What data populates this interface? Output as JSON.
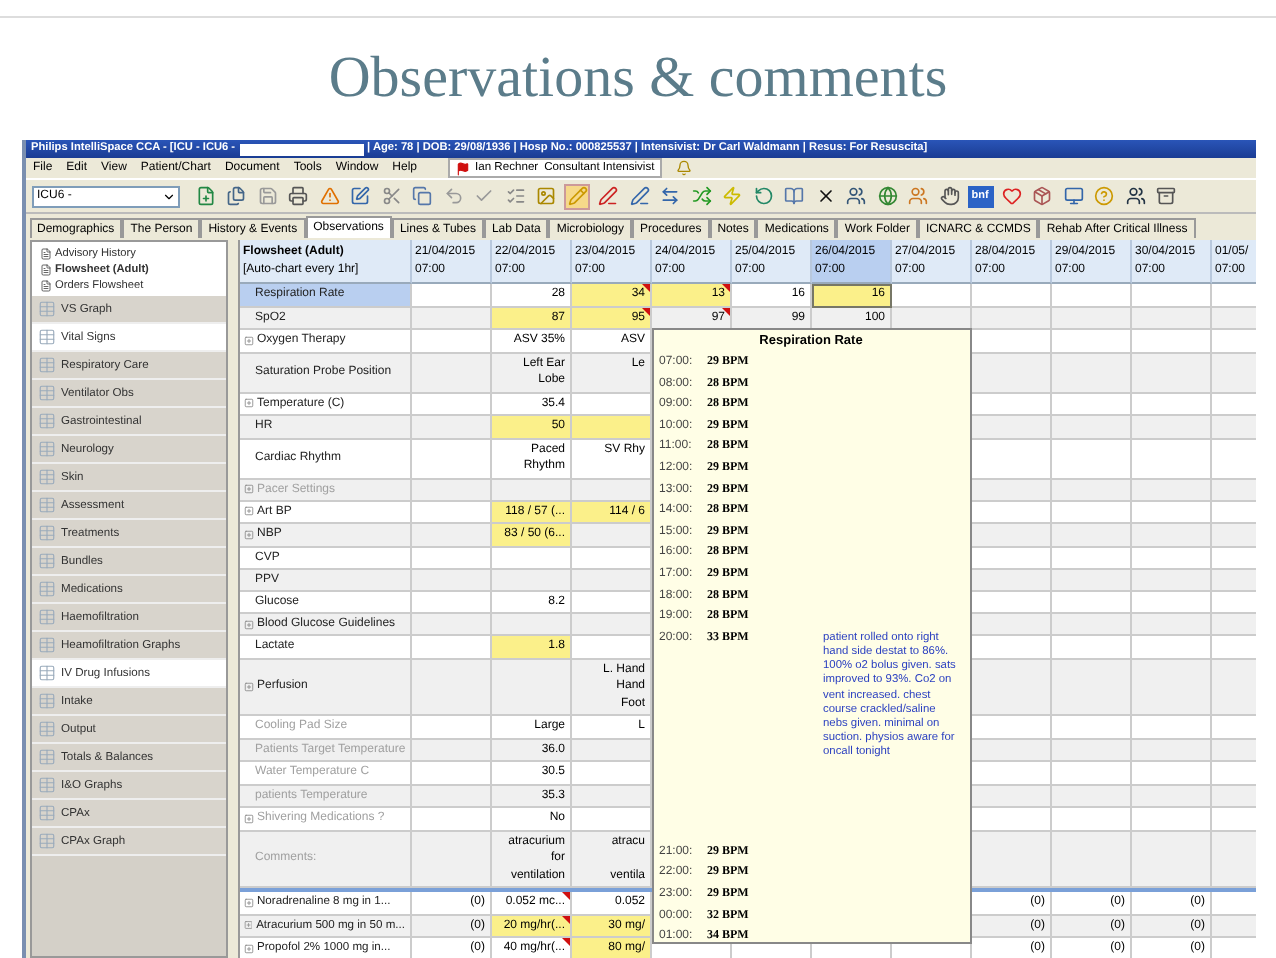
{
  "slide": {
    "title": "Observations & comments"
  },
  "window": {
    "title_left": "Philips IntelliSpace CCA - [ICU - ICU6 -",
    "title_right": "| Age: 78 | DOB: 29/08/1936 | Hosp No.: 000825537 | Intensivist: Dr Carl Waldmann | Resus: For Resuscita]"
  },
  "menu": [
    "File",
    "Edit",
    "View",
    "Patient/Chart",
    "Document",
    "Tools",
    "Window",
    "Help"
  ],
  "user": {
    "name": "Ian Rechner",
    "role": "Consultant Intensivist"
  },
  "toolbar": {
    "unit_select": "ICU6 -",
    "badge": "bnf"
  },
  "tabs": [
    {
      "label": "Demographics",
      "selected": false
    },
    {
      "label": "The Person",
      "selected": false
    },
    {
      "label": "History & Events",
      "selected": false
    },
    {
      "label": "Observations",
      "selected": true
    },
    {
      "label": "Lines & Tubes",
      "selected": false
    },
    {
      "label": "Lab Data",
      "selected": false
    },
    {
      "label": "Microbiology",
      "selected": false
    },
    {
      "label": "Procedures",
      "selected": false
    },
    {
      "label": "Notes",
      "selected": false
    },
    {
      "label": "Medications",
      "selected": false
    },
    {
      "label": "Work Folder",
      "selected": false
    },
    {
      "label": "ICNARC & CCMDS",
      "selected": false
    },
    {
      "label": "Rehab After Critical Illness",
      "selected": false
    }
  ],
  "sidebar": {
    "tree": [
      {
        "label": "Advisory History",
        "selected": false
      },
      {
        "label": "Flowsheet (Adult)",
        "selected": true
      },
      {
        "label": "Orders Flowsheet",
        "selected": false
      }
    ],
    "items": [
      {
        "label": "VS Graph",
        "selected": false
      },
      {
        "label": "Vital Signs",
        "selected": true
      },
      {
        "label": "Respiratory Care",
        "selected": false
      },
      {
        "label": "Ventilator Obs",
        "selected": false
      },
      {
        "label": "Gastrointestinal",
        "selected": false
      },
      {
        "label": "Neurology",
        "selected": false
      },
      {
        "label": "Skin",
        "selected": false
      },
      {
        "label": "Assessment",
        "selected": false
      },
      {
        "label": "Treatments",
        "selected": false
      },
      {
        "label": "Bundles",
        "selected": false
      },
      {
        "label": "Medications",
        "selected": false
      },
      {
        "label": "Haemofiltration",
        "selected": false
      },
      {
        "label": "Heamofiltration Graphs",
        "selected": false
      },
      {
        "label": "IV Drug Infusions",
        "selected": true
      },
      {
        "label": "Intake",
        "selected": false
      },
      {
        "label": "Output",
        "selected": false
      },
      {
        "label": "Totals & Balances",
        "selected": false
      },
      {
        "label": "I&O Graphs",
        "selected": false
      },
      {
        "label": "CPAx",
        "selected": false
      },
      {
        "label": "CPAx Graph",
        "selected": false
      }
    ]
  },
  "flowsheet": {
    "title": "Flowsheet (Adult)",
    "subtitle": "[Auto-chart every 1hr]",
    "columns": [
      {
        "date": "21/04/2015",
        "time": "07:00",
        "selected": false
      },
      {
        "date": "22/04/2015",
        "time": "07:00",
        "selected": false
      },
      {
        "date": "23/04/2015",
        "time": "07:00",
        "selected": false
      },
      {
        "date": "24/04/2015",
        "time": "07:00",
        "selected": false
      },
      {
        "date": "25/04/2015",
        "time": "07:00",
        "selected": false
      },
      {
        "date": "26/04/2015",
        "time": "07:00",
        "selected": true
      },
      {
        "date": "27/04/2015",
        "time": "07:00",
        "selected": false
      },
      {
        "date": "28/04/2015",
        "time": "07:00",
        "selected": false
      },
      {
        "date": "29/04/2015",
        "time": "07:00",
        "selected": false
      },
      {
        "date": "30/04/2015",
        "time": "07:00",
        "selected": false
      },
      {
        "date": "01/05/",
        "time": "07:00",
        "selected": false
      }
    ],
    "rows": [
      {
        "kind": "obs",
        "label": "Respiration Rate",
        "expandable": false,
        "disabled": false,
        "selected": true,
        "cells": [
          null,
          {
            "text": "28",
            "highlighted": false,
            "flagged": false
          },
          {
            "text": "34",
            "highlighted": true,
            "flagged": true
          },
          {
            "text": "13",
            "highlighted": true,
            "flagged": true
          },
          {
            "text": "16",
            "highlighted": false,
            "flagged": false
          },
          {
            "text": "16",
            "highlighted": true,
            "flagged": false
          },
          null,
          null,
          null,
          null,
          null
        ]
      },
      {
        "kind": "obs",
        "label": "SpO2",
        "expandable": false,
        "disabled": false,
        "selected": false,
        "cells": [
          null,
          {
            "text": "87",
            "highlighted": true,
            "flagged": false
          },
          {
            "text": "95",
            "highlighted": true,
            "flagged": true
          },
          {
            "text": "97",
            "highlighted": false,
            "flagged": true
          },
          {
            "text": "99",
            "highlighted": false,
            "flagged": false
          },
          {
            "text": "100",
            "highlighted": false,
            "flagged": false
          },
          null,
          null,
          null,
          null,
          null
        ]
      },
      {
        "kind": "obs",
        "label": "Oxygen Therapy",
        "expandable": true,
        "disabled": false,
        "selected": false,
        "cells": [
          null,
          {
            "text": "ASV 35%",
            "highlighted": false,
            "flagged": false
          },
          {
            "text": "ASV",
            "highlighted": false,
            "flagged": false
          },
          null,
          null,
          null,
          null,
          null,
          null,
          null,
          null
        ]
      },
      {
        "kind": "obs",
        "label": "Saturation Probe Position",
        "expandable": false,
        "disabled": false,
        "selected": false,
        "cells": [
          null,
          {
            "text": "Left Ear\nLobe",
            "highlighted": false,
            "flagged": false
          },
          {
            "text": "Le",
            "highlighted": false,
            "flagged": false
          },
          null,
          null,
          null,
          null,
          null,
          null,
          null,
          null
        ]
      },
      {
        "kind": "obs",
        "label": "Temperature (C)",
        "expandable": true,
        "disabled": false,
        "selected": false,
        "cells": [
          null,
          {
            "text": "35.4",
            "highlighted": false,
            "flagged": false
          },
          null,
          null,
          null,
          null,
          null,
          null,
          null,
          null,
          null
        ]
      },
      {
        "kind": "obs",
        "label": "HR",
        "expandable": false,
        "disabled": false,
        "selected": false,
        "cells": [
          null,
          {
            "text": "50",
            "highlighted": true,
            "flagged": false
          },
          {
            "highlighted": true,
            "flagged": false
          },
          null,
          null,
          null,
          null,
          null,
          null,
          null,
          null
        ]
      },
      {
        "kind": "obs",
        "label": "Cardiac Rhythm",
        "expandable": false,
        "disabled": false,
        "selected": false,
        "cells": [
          null,
          {
            "text": "Paced\nRhythm",
            "highlighted": false,
            "flagged": false
          },
          {
            "text": "SV Rhy",
            "highlighted": false,
            "flagged": false
          },
          null,
          null,
          null,
          null,
          null,
          null,
          null,
          null
        ]
      },
      {
        "kind": "obs",
        "label": "Pacer Settings",
        "expandable": true,
        "disabled": true,
        "selected": false,
        "cells": [
          null,
          null,
          null,
          null,
          null,
          null,
          null,
          null,
          null,
          null,
          null
        ]
      },
      {
        "kind": "obs",
        "label": "Art BP",
        "expandable": true,
        "disabled": false,
        "selected": false,
        "cells": [
          null,
          {
            "text": "118 / 57 (...",
            "highlighted": true,
            "flagged": false
          },
          {
            "text": "114 / 6",
            "highlighted": true,
            "flagged": false
          },
          null,
          null,
          null,
          null,
          null,
          null,
          null,
          null
        ]
      },
      {
        "kind": "obs",
        "label": "NBP",
        "expandable": true,
        "disabled": false,
        "selected": false,
        "cells": [
          null,
          {
            "text": "83 / 50 (6...",
            "highlighted": true,
            "flagged": false
          },
          null,
          null,
          null,
          null,
          null,
          null,
          null,
          null,
          null
        ]
      },
      {
        "kind": "obs",
        "label": "CVP",
        "expandable": false,
        "disabled": false,
        "selected": false,
        "cells": [
          null,
          null,
          null,
          null,
          null,
          null,
          null,
          null,
          null,
          null,
          null
        ]
      },
      {
        "kind": "obs",
        "label": "PPV",
        "expandable": false,
        "disabled": false,
        "selected": false,
        "cells": [
          null,
          null,
          null,
          null,
          null,
          null,
          null,
          null,
          null,
          null,
          null
        ]
      },
      {
        "kind": "obs",
        "label": "Glucose",
        "expandable": false,
        "disabled": false,
        "selected": false,
        "cells": [
          null,
          {
            "text": "8.2",
            "highlighted": false,
            "flagged": false
          },
          null,
          null,
          null,
          null,
          null,
          null,
          null,
          null,
          null
        ]
      },
      {
        "kind": "obs",
        "label": "Blood Glucose Guidelines",
        "expandable": true,
        "disabled": false,
        "selected": false,
        "cells": [
          null,
          null,
          null,
          null,
          null,
          null,
          null,
          null,
          null,
          null,
          null
        ]
      },
      {
        "kind": "obs",
        "label": "Lactate",
        "expandable": false,
        "disabled": false,
        "selected": false,
        "cells": [
          null,
          {
            "text": "1.8",
            "highlighted": true,
            "flagged": false
          },
          null,
          null,
          null,
          null,
          null,
          null,
          null,
          null,
          null
        ]
      },
      {
        "kind": "obs",
        "label": "Perfusion",
        "expandable": true,
        "disabled": false,
        "selected": false,
        "cells": [
          null,
          null,
          {
            "text": "L. Hand\nHand\nFoot",
            "highlighted": false,
            "flagged": false
          },
          null,
          null,
          null,
          null,
          null,
          null,
          null,
          null
        ]
      },
      {
        "kind": "obs",
        "label": "Cooling Pad Size",
        "expandable": false,
        "disabled": true,
        "selected": false,
        "cells": [
          null,
          {
            "text": "Large",
            "highlighted": false,
            "flagged": false
          },
          {
            "text": "L",
            "highlighted": false,
            "flagged": false
          },
          null,
          null,
          null,
          null,
          null,
          null,
          null,
          null
        ]
      },
      {
        "kind": "obs",
        "label": "Patients Target Temperature",
        "expandable": false,
        "disabled": true,
        "selected": false,
        "cells": [
          null,
          {
            "text": "36.0",
            "highlighted": false,
            "flagged": false
          },
          null,
          null,
          null,
          null,
          null,
          null,
          null,
          null,
          null
        ]
      },
      {
        "kind": "obs",
        "label": "Water Temperature C",
        "expandable": false,
        "disabled": true,
        "selected": false,
        "cells": [
          null,
          {
            "text": "30.5",
            "highlighted": false,
            "flagged": false
          },
          null,
          null,
          null,
          null,
          null,
          null,
          null,
          null,
          null
        ]
      },
      {
        "kind": "obs",
        "label": "patients Temperature",
        "expandable": false,
        "disabled": true,
        "selected": false,
        "cells": [
          null,
          {
            "text": "35.3",
            "highlighted": false,
            "flagged": false
          },
          null,
          null,
          null,
          null,
          null,
          null,
          null,
          null,
          null
        ]
      },
      {
        "kind": "obs",
        "label": "Shivering Medications ?",
        "expandable": true,
        "disabled": true,
        "selected": false,
        "cells": [
          null,
          {
            "text": "No",
            "highlighted": false,
            "flagged": false
          },
          null,
          null,
          null,
          null,
          null,
          null,
          null,
          null,
          null
        ]
      },
      {
        "kind": "obs",
        "label": "Comments:",
        "expandable": false,
        "disabled": true,
        "selected": false,
        "cells": [
          null,
          {
            "text": "atracurium\nfor\nventilation",
            "highlighted": false,
            "flagged": false
          },
          {
            "text": "atracu\n\nventila",
            "highlighted": false,
            "flagged": false
          },
          null,
          null,
          null,
          null,
          null,
          null,
          null,
          null
        ]
      },
      {
        "kind": "drug",
        "label": "Noradrenaline 8 mg in 1...",
        "expandable": true,
        "disabled": false,
        "selected": false,
        "cells": [
          {
            "text": "(0)",
            "highlighted": false,
            "flagged": false
          },
          {
            "text": "0.052 mc...",
            "highlighted": false,
            "flagged": true
          },
          {
            "text": "0.052",
            "highlighted": false,
            "flagged": false
          },
          null,
          null,
          null,
          null,
          {
            "text": "(0)",
            "highlighted": false,
            "flagged": false
          },
          {
            "text": "(0)",
            "highlighted": false,
            "flagged": false
          },
          {
            "text": "(0)",
            "highlighted": false,
            "flagged": false
          },
          null
        ]
      },
      {
        "kind": "drug",
        "label": "Atracurium 500 mg in 50 m...",
        "expandable": true,
        "disabled": false,
        "selected": false,
        "cells": [
          {
            "text": "(0)",
            "highlighted": false,
            "flagged": false
          },
          {
            "text": "20 mg/hr(...",
            "highlighted": true,
            "flagged": true
          },
          {
            "text": "30 mg/",
            "highlighted": true,
            "flagged": false
          },
          null,
          null,
          null,
          null,
          {
            "text": "(0)",
            "highlighted": false,
            "flagged": false
          },
          {
            "text": "(0)",
            "highlighted": false,
            "flagged": false
          },
          {
            "text": "(0)",
            "highlighted": false,
            "flagged": false
          },
          null
        ]
      },
      {
        "kind": "drug",
        "label": "Propofol 2% 1000 mg in...",
        "expandable": true,
        "disabled": false,
        "selected": false,
        "cells": [
          {
            "text": "(0)",
            "highlighted": false,
            "flagged": false
          },
          {
            "text": "40 mg/hr(...",
            "highlighted": false,
            "flagged": true
          },
          {
            "text": "80 mg/",
            "highlighted": true,
            "flagged": false
          },
          null,
          null,
          null,
          null,
          {
            "text": "(0)",
            "highlighted": false,
            "flagged": false
          },
          {
            "text": "(0)",
            "highlighted": false,
            "flagged": false
          },
          {
            "text": "(0)",
            "highlighted": false,
            "flagged": false
          },
          null
        ]
      }
    ]
  },
  "popup": {
    "title": "Respiration Rate",
    "entries": [
      {
        "time": "07:00:",
        "value": "29 BPM"
      },
      {
        "time": "08:00:",
        "value": "28 BPM"
      },
      {
        "time": "09:00:",
        "value": "28 BPM"
      },
      {
        "time": "10:00:",
        "value": "29 BPM"
      },
      {
        "time": "11:00:",
        "value": "28 BPM"
      },
      {
        "time": "12:00:",
        "value": "29 BPM"
      },
      {
        "time": "13:00:",
        "value": "29 BPM"
      },
      {
        "time": "14:00:",
        "value": "28 BPM"
      },
      {
        "time": "15:00:",
        "value": "29 BPM"
      },
      {
        "time": "16:00:",
        "value": "28 BPM"
      },
      {
        "time": "17:00:",
        "value": "29 BPM"
      },
      {
        "time": "18:00:",
        "value": "28 BPM"
      },
      {
        "time": "19:00:",
        "value": "28 BPM"
      },
      {
        "time": "20:00:",
        "value": "33 BPM",
        "note": "patient rolled onto right hand side destat to 86%. 100% o2 bolus given. sats improved to 93%. Co2 on vent increased. chest course crackled/saline nebs given. minimal on suction. physios aware for oncall tonight"
      },
      {
        "time": "21:00:",
        "value": "29 BPM"
      },
      {
        "time": "22:00:",
        "value": "29 BPM"
      },
      {
        "time": "23:00:",
        "value": "29 BPM"
      },
      {
        "time": "00:00:",
        "value": "32 BPM"
      },
      {
        "time": "01:00:",
        "value": "34 BPM"
      }
    ]
  }
}
